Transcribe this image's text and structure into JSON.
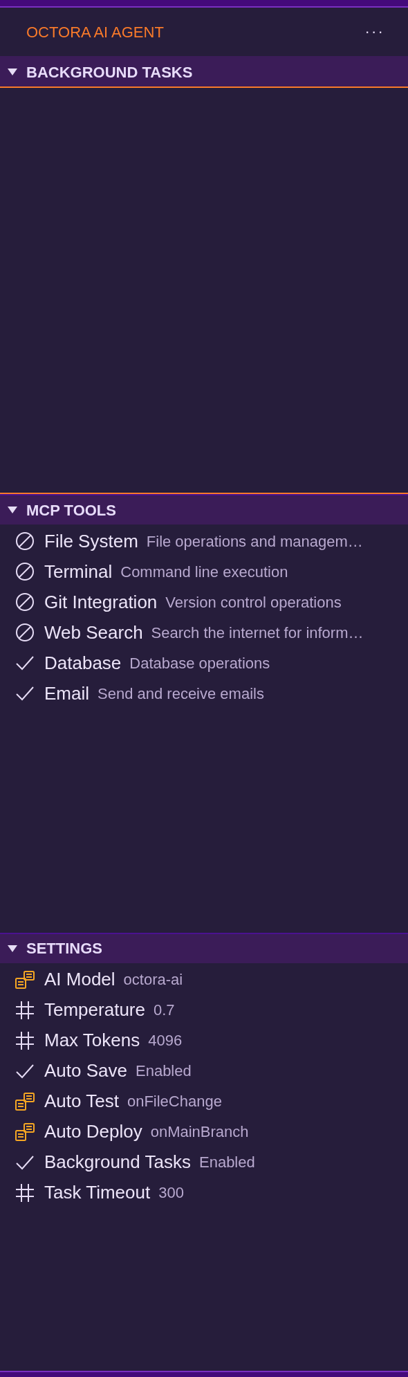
{
  "header": {
    "title": "OCTORA AI AGENT",
    "more": "···"
  },
  "sections": [
    {
      "title": "BACKGROUND TASKS",
      "expanded": true,
      "focused": true
    },
    {
      "title": "MCP TOOLS",
      "expanded": true,
      "focused": false,
      "items": [
        {
          "kind": "disabled",
          "label": "File System",
          "detail": "File operations and managem…"
        },
        {
          "kind": "disabled",
          "label": "Terminal",
          "detail": "Command line execution"
        },
        {
          "kind": "disabled",
          "label": "Git Integration",
          "detail": "Version control operations"
        },
        {
          "kind": "disabled",
          "label": "Web Search",
          "detail": "Search the internet for inform…"
        },
        {
          "kind": "check",
          "label": "Database",
          "detail": "Database operations"
        },
        {
          "kind": "check",
          "label": "Email",
          "detail": "Send and receive emails"
        }
      ]
    },
    {
      "title": "SETTINGS",
      "expanded": true,
      "focused": false,
      "items": [
        {
          "kind": "enum",
          "label": "AI Model",
          "detail": "octora-ai"
        },
        {
          "kind": "number",
          "label": "Temperature",
          "detail": "0.7"
        },
        {
          "kind": "number",
          "label": "Max Tokens",
          "detail": "4096"
        },
        {
          "kind": "check",
          "label": "Auto Save",
          "detail": "Enabled"
        },
        {
          "kind": "enum",
          "label": "Auto Test",
          "detail": "onFileChange"
        },
        {
          "kind": "enum",
          "label": "Auto Deploy",
          "detail": "onMainBranch"
        },
        {
          "kind": "check",
          "label": "Background Tasks",
          "detail": "Enabled"
        },
        {
          "kind": "number",
          "label": "Task Timeout",
          "detail": "300"
        }
      ]
    }
  ]
}
